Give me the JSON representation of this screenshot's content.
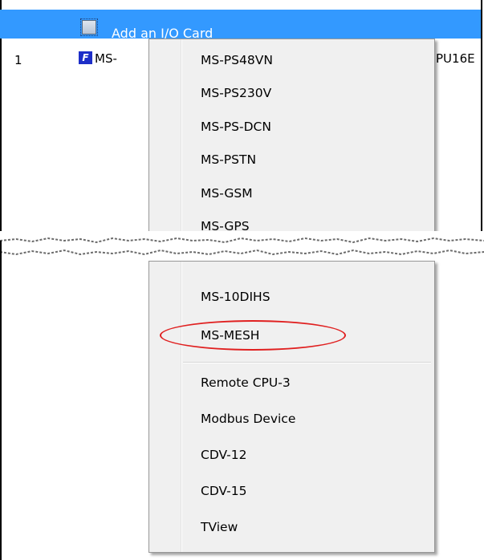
{
  "header": {
    "title": "Add an I/O Card"
  },
  "row": {
    "number": "1",
    "icon_label": "F",
    "text_left": "MS-",
    "text_right": "PU16E"
  },
  "menu_top": {
    "items": [
      {
        "label": "MS-PS48VN"
      },
      {
        "label": "MS-PS230V"
      },
      {
        "label": "MS-PS-DCN"
      },
      {
        "label": "MS-PSTN"
      },
      {
        "label": "MS-GSM"
      },
      {
        "label": "MS-GPS"
      }
    ]
  },
  "menu_bottom": {
    "items": [
      {
        "label": "MS-10DIHS"
      },
      {
        "label": "MS-MESH",
        "highlighted": true
      },
      {
        "label": "Remote CPU-3"
      },
      {
        "label": "Modbus Device"
      },
      {
        "label": "CDV-12"
      },
      {
        "label": "CDV-15"
      },
      {
        "label": "TView"
      }
    ]
  },
  "colors": {
    "header_bg": "#3399ff",
    "menu_bg": "#f0f0f0",
    "highlight": "#e02020"
  }
}
